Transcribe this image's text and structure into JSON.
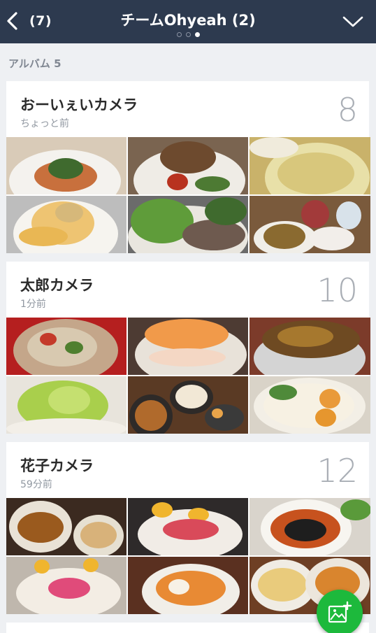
{
  "header": {
    "back_count": "(7)",
    "title": "チームOhyeah (2)",
    "page_indicator": {
      "total": 3,
      "active": 3
    }
  },
  "section_label": "アルバム 5",
  "albums": [
    {
      "name": "おーいぇいカメラ",
      "time": "ちょっと前",
      "count": "8"
    },
    {
      "name": "太郎カメラ",
      "time": "1分前",
      "count": "10"
    },
    {
      "name": "花子カメラ",
      "time": "59分前",
      "count": "12"
    }
  ],
  "icons": {
    "back": "chevron-left-icon",
    "collapse": "chevron-down-icon",
    "add_photo": "add-photo-icon"
  },
  "colors": {
    "header_bg": "#2d3a4f",
    "fab": "#1db93c",
    "background": "#eef0f3"
  }
}
